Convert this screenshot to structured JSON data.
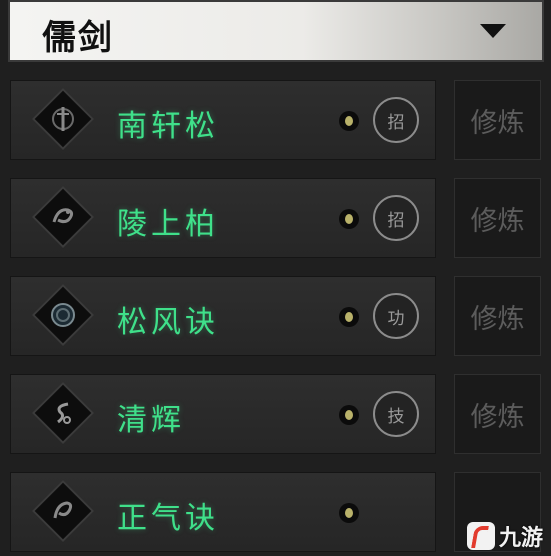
{
  "header": {
    "title": "儒剑"
  },
  "skills": [
    {
      "name": "南轩松",
      "badge": "招",
      "action": "修炼",
      "icon": "sword-emblem-icon"
    },
    {
      "name": "陵上柏",
      "badge": "招",
      "action": "修炼",
      "icon": "dragon-emblem-icon"
    },
    {
      "name": "松风诀",
      "badge": "功",
      "action": "修炼",
      "icon": "orb-emblem-icon"
    },
    {
      "name": "清辉",
      "badge": "技",
      "action": "修炼",
      "icon": "swirl-emblem-icon"
    },
    {
      "name": "正气诀",
      "badge": "",
      "action": "",
      "icon": "dragon-emblem-icon"
    }
  ],
  "watermark": {
    "text": "九游"
  },
  "colors": {
    "skill_name": "#3fe08a",
    "badge_border": "#8c8c8c",
    "practice_text": "#5c5c5c"
  }
}
